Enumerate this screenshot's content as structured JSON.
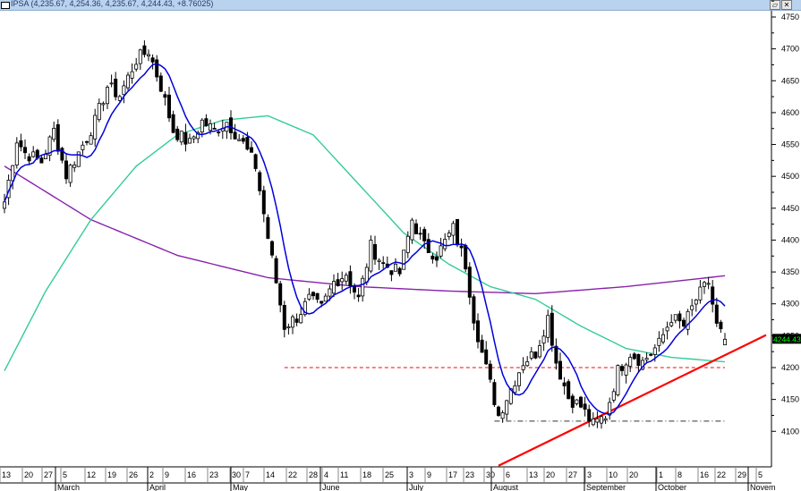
{
  "window": {
    "title": "IPSA (4,235.67, 4,254.36, 4,235.67, 4,244.43, +8.76025)",
    "restore_label": "▱",
    "close_label": "✕"
  },
  "chart_data": {
    "type": "candlestick",
    "symbol": "IPSA",
    "last_price_label": "4244.430",
    "ylim": [
      4075,
      4760
    ],
    "y_ticks": [
      "4100",
      "4150",
      "4200",
      "4250",
      "4300",
      "4350",
      "4400",
      "4450",
      "4500",
      "4550",
      "4600",
      "4650",
      "4700",
      "4750"
    ],
    "x_day_labels": [
      "13",
      "20",
      "27",
      "5",
      "12",
      "19",
      "26",
      "2",
      "9",
      "16",
      "23",
      "30",
      "7",
      "14",
      "22",
      "28",
      "4",
      "11",
      "18",
      "25",
      "3",
      "9",
      "17",
      "23",
      "30",
      "6",
      "13",
      "20",
      "27",
      "3",
      "10",
      "20",
      "1",
      "8",
      "16",
      "22",
      "29",
      "5"
    ],
    "x_month_labels": [
      "March",
      "April",
      "May",
      "June",
      "July",
      "August",
      "September",
      "October",
      "Novem"
    ],
    "close_keypoints": {
      "day": [
        0,
        3,
        5,
        9,
        12,
        15,
        18,
        22,
        25,
        28,
        32,
        35,
        38,
        41,
        45,
        48,
        51,
        54,
        58,
        61,
        64,
        66,
        68,
        71,
        74,
        77,
        80,
        83,
        86,
        89,
        92,
        96,
        99,
        102,
        105,
        109,
        112,
        114,
        116,
        120,
        123,
        126,
        129,
        132,
        134,
        137,
        140,
        143,
        146,
        149,
        152,
        155,
        159,
        162,
        165,
        168,
        171,
        173,
        175
      ],
      "close": [
        4460,
        4558,
        4537,
        4523,
        4572,
        4502,
        4537,
        4586,
        4641,
        4627,
        4683,
        4697,
        4641,
        4572,
        4551,
        4586,
        4572,
        4586,
        4551,
        4516,
        4404,
        4334,
        4265,
        4279,
        4307,
        4293,
        4334,
        4348,
        4307,
        4390,
        4362,
        4348,
        4432,
        4390,
        4376,
        4418,
        4362,
        4279,
        4223,
        4125,
        4167,
        4209,
        4223,
        4279,
        4209,
        4153,
        4139,
        4110,
        4125,
        4195,
        4223,
        4209,
        4237,
        4279,
        4265,
        4307,
        4334,
        4265,
        4244
      ]
    },
    "last_bar": {
      "open": 4235.67,
      "high": 4254.36,
      "low": 4235.67,
      "close": 4244.43,
      "change": 8.76025
    },
    "moving_averages": [
      {
        "name": "short MA",
        "color": "#0000dd",
        "period_days": 8
      },
      {
        "name": "medium MA",
        "color": "#33cc99",
        "day": [
          0,
          10,
          21,
          32,
          42,
          53,
          64,
          75,
          86,
          97,
          108,
          118,
          129,
          140,
          151,
          162,
          175
        ],
        "value": [
          4195,
          4320,
          4432,
          4516,
          4565,
          4588,
          4595,
          4565,
          4488,
          4411,
          4362,
          4327,
          4307,
          4265,
          4230,
          4216,
          4209
        ]
      },
      {
        "name": "long MA",
        "color": "#8822aa",
        "day": [
          0,
          21,
          42,
          64,
          86,
          108,
          129,
          151,
          175
        ],
        "value": [
          4516,
          4432,
          4376,
          4341,
          4327,
          4320,
          4316,
          4327,
          4344
        ]
      }
    ],
    "annotations": [
      {
        "type": "horizontal",
        "style": "dashed",
        "color": "#ff0000",
        "price": 4200,
        "from_day": 68,
        "to_day": 175
      },
      {
        "type": "horizontal",
        "style": "dash-dot",
        "color": "#333333",
        "price": 4116,
        "from_day": 119,
        "to_day": 175
      },
      {
        "type": "trendline",
        "color": "#ff0000",
        "from": {
          "day": 120,
          "price": 4046
        },
        "to": {
          "day": 185,
          "price": 4251
        }
      }
    ],
    "colors": {
      "up": "#ffffff",
      "down": "#000000",
      "price_tag_bg": "#000000",
      "price_tag_text": "#00ff00"
    }
  }
}
